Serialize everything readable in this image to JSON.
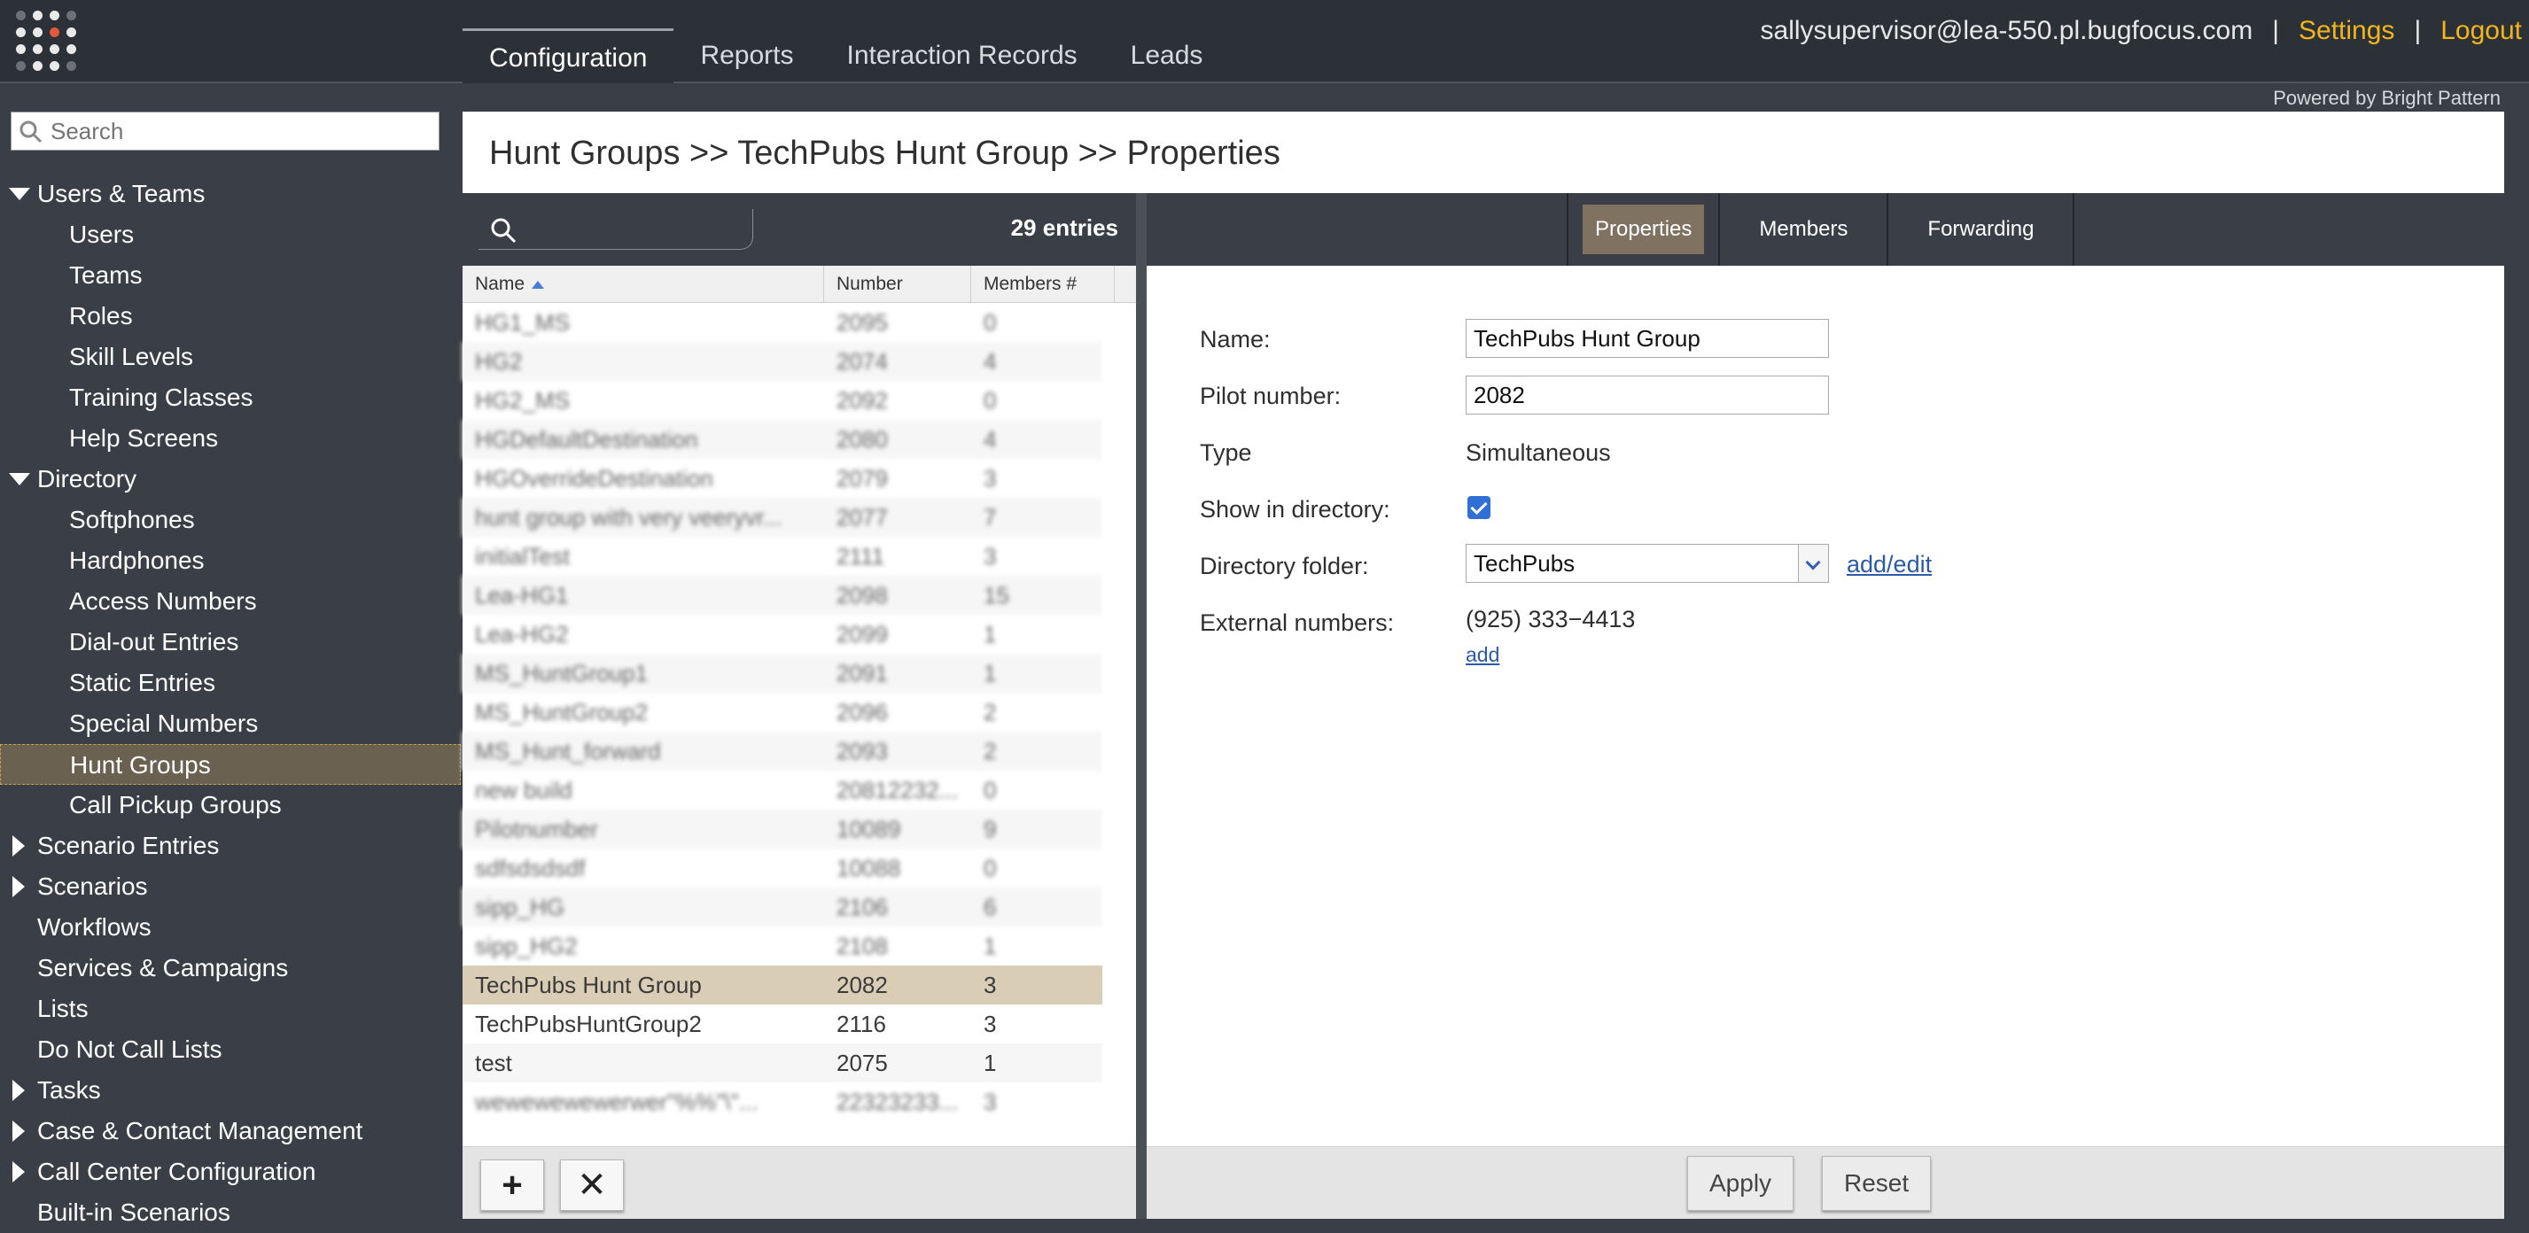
{
  "topbar": {
    "nav_tabs": [
      {
        "label": "Configuration",
        "active": true
      },
      {
        "label": "Reports"
      },
      {
        "label": "Interaction Records"
      },
      {
        "label": "Leads"
      }
    ],
    "user_email": "sallysupervisor@lea-550.pl.bugfocus.com",
    "separator": "|",
    "settings_label": "Settings",
    "logout_label": "Logout",
    "powered_by": "Powered by Bright Pattern",
    "accent_color": "#f2b51c"
  },
  "sidebar": {
    "search_placeholder": "Search",
    "tree": [
      {
        "label": "Users & Teams",
        "level": 1,
        "arrow": "down"
      },
      {
        "label": "Users",
        "level": 2
      },
      {
        "label": "Teams",
        "level": 2
      },
      {
        "label": "Roles",
        "level": 2
      },
      {
        "label": "Skill Levels",
        "level": 2
      },
      {
        "label": "Training Classes",
        "level": 2
      },
      {
        "label": "Help Screens",
        "level": 2
      },
      {
        "label": "Directory",
        "level": 1,
        "arrow": "down"
      },
      {
        "label": "Softphones",
        "level": 2
      },
      {
        "label": "Hardphones",
        "level": 2
      },
      {
        "label": "Access Numbers",
        "level": 2
      },
      {
        "label": "Dial-out Entries",
        "level": 2
      },
      {
        "label": "Static Entries",
        "level": 2
      },
      {
        "label": "Special Numbers",
        "level": 2
      },
      {
        "label": "Hunt Groups",
        "level": 2,
        "selected": true
      },
      {
        "label": "Call Pickup Groups",
        "level": 2
      },
      {
        "label": "Scenario Entries",
        "level": 1,
        "arrow": "right"
      },
      {
        "label": "Scenarios",
        "level": 1,
        "arrow": "right"
      },
      {
        "label": "Workflows",
        "level": 1
      },
      {
        "label": "Services & Campaigns",
        "level": 1
      },
      {
        "label": "Lists",
        "level": 1
      },
      {
        "label": "Do Not Call Lists",
        "level": 1
      },
      {
        "label": "Tasks",
        "level": 1,
        "arrow": "right"
      },
      {
        "label": "Case & Contact Management",
        "level": 1,
        "arrow": "right"
      },
      {
        "label": "Call Center Configuration",
        "level": 1,
        "arrow": "right"
      },
      {
        "label": "Built-in Scenarios",
        "level": 1
      }
    ]
  },
  "main": {
    "breadcrumb": "Hunt Groups >> TechPubs Hunt Group >> Properties"
  },
  "list": {
    "entries_label": "29 entries",
    "columns": {
      "name": "Name",
      "number": "Number",
      "members": "Members #"
    },
    "rows": [
      {
        "name": "HG1_MS",
        "number": "2095",
        "members": "0",
        "blurred": true
      },
      {
        "name": "HG2",
        "number": "2074",
        "members": "4",
        "blurred": true
      },
      {
        "name": "HG2_MS",
        "number": "2092",
        "members": "0",
        "blurred": true
      },
      {
        "name": "HGDefaultDestination",
        "number": "2080",
        "members": "4",
        "blurred": true
      },
      {
        "name": "HGOverrideDestination",
        "number": "2079",
        "members": "3",
        "blurred": true
      },
      {
        "name": "hunt group with very veeryvr...",
        "number": "2077",
        "members": "7",
        "blurred": true
      },
      {
        "name": "initialTest",
        "number": "2111",
        "members": "3",
        "blurred": true
      },
      {
        "name": "Lea-HG1",
        "number": "2098",
        "members": "15",
        "blurred": true
      },
      {
        "name": "Lea-HG2",
        "number": "2099",
        "members": "1",
        "blurred": true
      },
      {
        "name": "MS_HuntGroup1",
        "number": "2091",
        "members": "1",
        "blurred": true
      },
      {
        "name": "MS_HuntGroup2",
        "number": "2096",
        "members": "2",
        "blurred": true
      },
      {
        "name": "MS_Hunt_forward",
        "number": "2093",
        "members": "2",
        "blurred": true
      },
      {
        "name": "new build",
        "number": "20812232...",
        "members": "0",
        "blurred": true
      },
      {
        "name": "Pilotnumber",
        "number": "10089",
        "members": "9",
        "blurred": true
      },
      {
        "name": "sdfsdsdsdf",
        "number": "10088",
        "members": "0",
        "blurred": true
      },
      {
        "name": "sipp_HG",
        "number": "2106",
        "members": "6",
        "blurred": true
      },
      {
        "name": "sipp_HG2",
        "number": "2108",
        "members": "1",
        "blurred": true
      },
      {
        "name": "TechPubs Hunt Group",
        "number": "2082",
        "members": "3",
        "selected": true
      },
      {
        "name": "TechPubsHuntGroup2",
        "number": "2116",
        "members": "3"
      },
      {
        "name": "test",
        "number": "2075",
        "members": "1"
      },
      {
        "name": "wewewewewerwer\"%%\"\\\"...",
        "number": "22323233...",
        "members": "3",
        "blurred": true
      }
    ],
    "add_label": "+",
    "delete_label": "✕"
  },
  "details": {
    "tabs": [
      {
        "label": "Properties",
        "active": true
      },
      {
        "label": "Members"
      },
      {
        "label": "Forwarding"
      }
    ],
    "name_label": "Name:",
    "name_value": "TechPubs Hunt Group",
    "pilot_label": "Pilot number:",
    "pilot_value": "2082",
    "type_label": "Type",
    "type_value": "Simultaneous",
    "show_dir_label": "Show in directory:",
    "show_dir_checked": true,
    "dir_folder_label": "Directory folder:",
    "dir_folder_value": "TechPubs",
    "add_edit_label": "add/edit",
    "ext_label": "External numbers:",
    "ext_value": "(925) 333−4413",
    "add_label": "add",
    "apply_label": "Apply",
    "reset_label": "Reset"
  }
}
